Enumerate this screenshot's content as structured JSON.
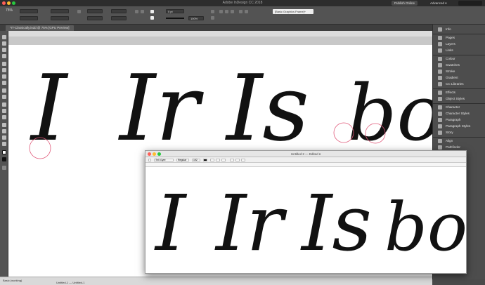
{
  "menubar": {
    "app_title": "Adobe InDesign CC 2018",
    "publish_label": "Publish Online",
    "workspace_label": "Advanced ▾"
  },
  "control": {
    "zoom": "75%",
    "stroke_weight": "0 pt",
    "percent": "100%",
    "frame_style": "[Basic Graphics Frame]+"
  },
  "document": {
    "tab_label": "*IT-Classically.indd @ 75% [GPU Preview]"
  },
  "canvas": {
    "glyph_groups": [
      "I",
      "Ir",
      "Is",
      "bor"
    ]
  },
  "panel": {
    "items": [
      "Info",
      "Pages",
      "Layers",
      "Links",
      "Colour",
      "Swatches",
      "Stroke",
      "Gradient",
      "CC Libraries",
      "Effects",
      "Object Styles",
      "Character",
      "Character Styles",
      "Paragraph",
      "Paragraph Styles",
      "Story",
      "Align",
      "Pathfinder"
    ]
  },
  "window2": {
    "title": "Untitled 2 — Edited ▾",
    "font_name": "TeX Gyre",
    "style_name": "Regular",
    "size_value": "192",
    "glyph_groups": [
      "I",
      "Ir",
      "Is",
      "bor"
    ]
  },
  "status": {
    "left_text": "Basic (working)",
    "note_text": "Untitled-1 — Untitled-1"
  }
}
